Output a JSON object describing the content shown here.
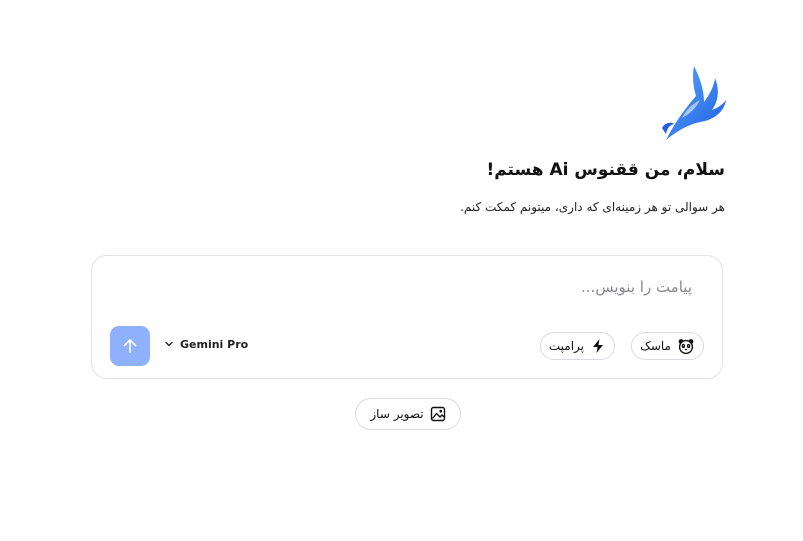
{
  "welcome": {
    "title": "سلام، من ققنوس Ai هستم!",
    "subtitle": "هر سوالی تو هر زمینه‌ای که داری، میتونم کمکت کنم."
  },
  "composer": {
    "placeholder": "پیامت را بنویس...",
    "value": "",
    "model": {
      "selected": "Gemini Pro",
      "icon": "chevron-down-icon"
    },
    "send_icon": "arrow-up-icon",
    "chips": [
      {
        "label": "ماسک",
        "icon": "panda-mask-icon"
      },
      {
        "label": "پرامپت",
        "icon": "lightning-icon"
      }
    ]
  },
  "tools": {
    "image_maker_label": "تصویر ساز",
    "image_maker_icon": "image-icon"
  },
  "colors": {
    "brand": "#2f7cf0",
    "send_button": "#8fb1fb",
    "border": "#e3e3e6"
  }
}
